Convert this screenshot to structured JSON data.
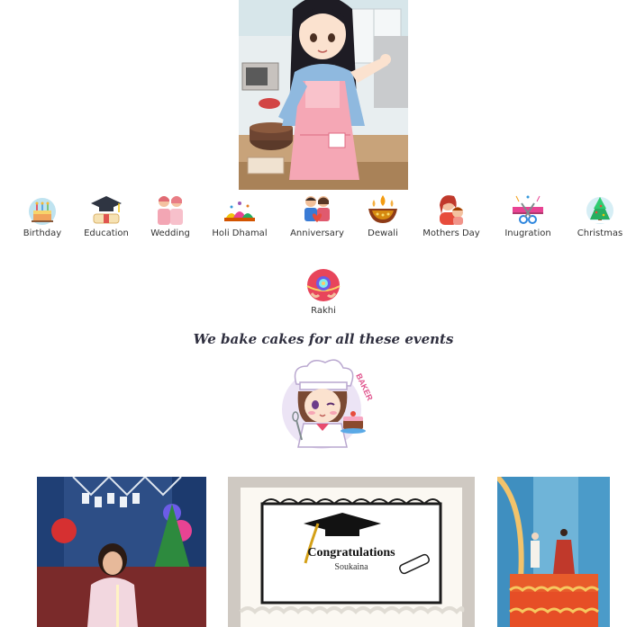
{
  "events": [
    {
      "label": "Birthday",
      "icon": "birthday-cake-icon"
    },
    {
      "label": "Education",
      "icon": "graduation-cap-icon"
    },
    {
      "label": "Wedding",
      "icon": "wedding-couple-icon"
    },
    {
      "label": "Holi Dhamal",
      "icon": "holi-colors-icon"
    },
    {
      "label": "Anniversary",
      "icon": "anniversary-couple-icon"
    },
    {
      "label": "Dewali",
      "icon": "diya-lamp-icon"
    },
    {
      "label": "Mothers Day",
      "icon": "mother-child-icon"
    },
    {
      "label": "Inugration",
      "icon": "ribbon-cutting-icon"
    },
    {
      "label": "Christmas",
      "icon": "christmas-tree-icon"
    }
  ],
  "rakhi": {
    "label": "Rakhi",
    "icon": "rakhi-icon"
  },
  "tagline": "We bake cakes for all these events",
  "baker_logo": {
    "text": "BAKER"
  },
  "gallery": {
    "cake_text": "Congratulations",
    "cake_name": "Soukaina"
  }
}
